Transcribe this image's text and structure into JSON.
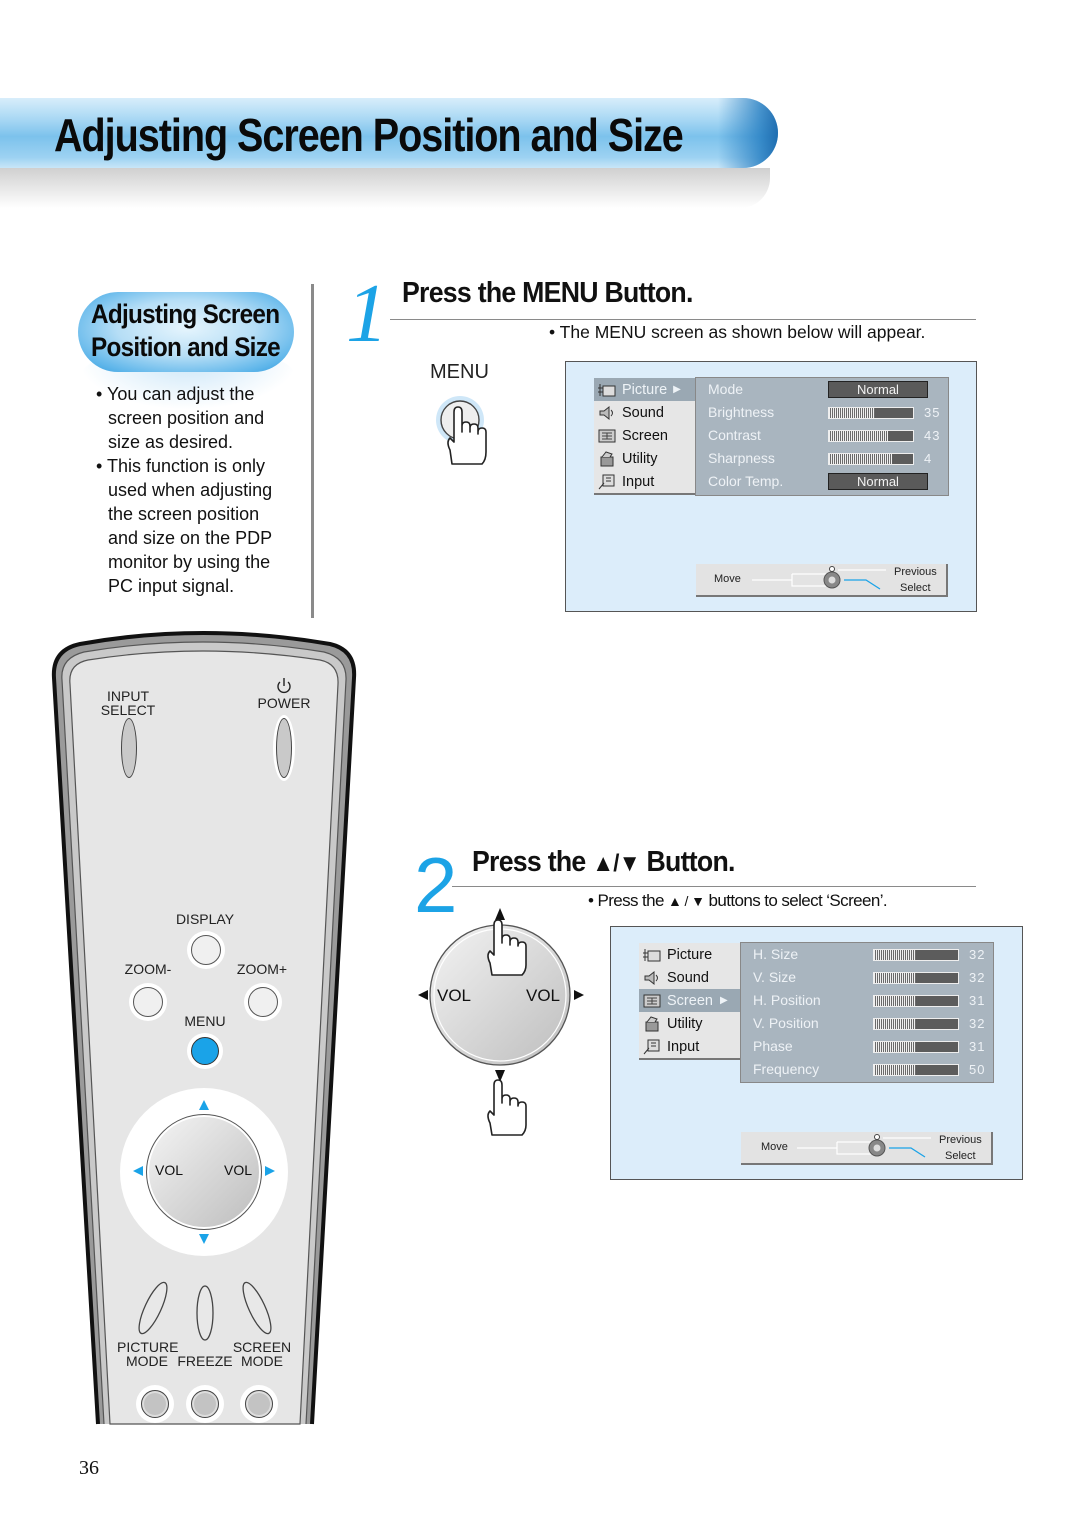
{
  "page": {
    "title": "Adjusting Screen Position and Size",
    "page_number": "36",
    "accent_color": "#1ca3e6"
  },
  "sidebar": {
    "heading_line1": "Adjusting Screen",
    "heading_line2": "Position and Size",
    "bullets": [
      "• You can adjust the screen position and size as desired.",
      "• This function is only used when adjusting the screen position and size on the PDP monitor by using the PC input signal."
    ]
  },
  "step1": {
    "number": "1",
    "title": "Press the MENU Button.",
    "note": "• The MENU screen as shown below will appear.",
    "button_label": "MENU",
    "osd": {
      "menu_items": [
        {
          "label": "Picture",
          "icon": "picture-icon",
          "selected": true
        },
        {
          "label": "Sound",
          "icon": "sound-icon",
          "selected": false
        },
        {
          "label": "Screen",
          "icon": "screen-icon",
          "selected": false
        },
        {
          "label": "Utility",
          "icon": "utility-icon",
          "selected": false
        },
        {
          "label": "Input",
          "icon": "input-icon",
          "selected": false
        }
      ],
      "selected_arrow": "▶",
      "settings": [
        {
          "label": "Mode",
          "type": "select",
          "value": "Normal"
        },
        {
          "label": "Brightness",
          "type": "slider",
          "value": "35",
          "level": 0.55
        },
        {
          "label": "Contrast",
          "type": "slider",
          "value": "43",
          "level": 0.7
        },
        {
          "label": "Sharpness",
          "type": "slider",
          "value": "4",
          "level": 0.75
        },
        {
          "label": "Color Temp.",
          "type": "select",
          "value": "Normal"
        }
      ],
      "nav": {
        "move": "Move",
        "previous": "Previous",
        "select": "Select"
      }
    }
  },
  "step2": {
    "number": "2",
    "title_prefix": "Press the",
    "title_arrows": "▲/▼",
    "title_suffix": "Button.",
    "note_prefix": "• Press the",
    "note_arrows": "▲ / ▼",
    "note_suffix": "buttons to select ‘Screen’.",
    "dpad": {
      "left_label": "VOL",
      "right_label": "VOL"
    },
    "osd": {
      "menu_items": [
        {
          "label": "Picture",
          "icon": "picture-icon",
          "selected": false
        },
        {
          "label": "Sound",
          "icon": "sound-icon",
          "selected": false
        },
        {
          "label": "Screen",
          "icon": "screen-icon",
          "selected": true
        },
        {
          "label": "Utility",
          "icon": "utility-icon",
          "selected": false
        },
        {
          "label": "Input",
          "icon": "input-icon",
          "selected": false
        }
      ],
      "selected_arrow": "▶",
      "settings": [
        {
          "label": "H. Size",
          "type": "slider",
          "value": "32",
          "level": 0.5
        },
        {
          "label": "V. Size",
          "type": "slider",
          "value": "32",
          "level": 0.5
        },
        {
          "label": "H. Position",
          "type": "slider",
          "value": "31",
          "level": 0.5
        },
        {
          "label": "V. Position",
          "type": "slider",
          "value": "32",
          "level": 0.5
        },
        {
          "label": "Phase",
          "type": "slider",
          "value": "31",
          "level": 0.5
        },
        {
          "label": "Frequency",
          "type": "slider",
          "value": "50",
          "level": 0.5
        }
      ],
      "nav": {
        "move": "Move",
        "previous": "Previous",
        "select": "Select"
      }
    }
  },
  "remote": {
    "input_select": "INPUT\nSELECT",
    "input_line1": "INPUT",
    "input_line2": "SELECT",
    "power": "POWER",
    "display": "DISPLAY",
    "zoom_minus": "ZOOM-",
    "zoom_plus": "ZOOM+",
    "menu": "MENU",
    "vol_left": "VOL",
    "vol_right": "VOL",
    "picture_mode_line1": "PICTURE",
    "picture_mode_line2": "MODE",
    "freeze": "FREEZE",
    "screen_mode_line1": "SCREEN",
    "screen_mode_line2": "MODE",
    "menu_button_color": "#1aa3e8"
  }
}
